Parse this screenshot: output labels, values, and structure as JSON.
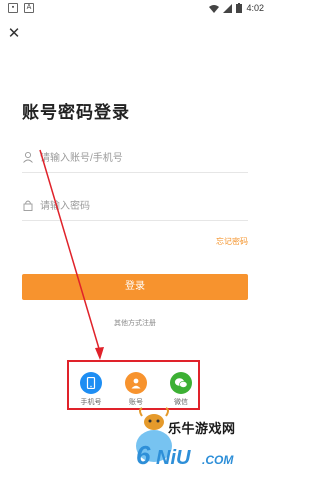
{
  "status_bar": {
    "time": "4:02",
    "left_icons": [
      "notification-badge-icon",
      "a-badge-icon"
    ],
    "right_icons": [
      "wifi-icon",
      "signal-icon",
      "battery-icon"
    ]
  },
  "page": {
    "title": "账号密码登录"
  },
  "account_field": {
    "placeholder": "请输入账号/手机号",
    "icon": "user-icon"
  },
  "password_field": {
    "placeholder": "请输入密码",
    "icon": "lock-icon"
  },
  "forgot_password": "忘记密码",
  "login_button": "登录",
  "other_methods": {
    "label": "其他方式注册",
    "options": [
      {
        "label": "手机号",
        "icon": "phone-icon",
        "color": "#1e8ef3"
      },
      {
        "label": "账号",
        "icon": "person-icon",
        "color": "#f7932e"
      },
      {
        "label": "微信",
        "icon": "wechat-icon",
        "color": "#3cb034"
      }
    ]
  },
  "watermark": {
    "text": "乐牛游戏网",
    "logo_text": "6NiU.COM"
  },
  "colors": {
    "accent": "#f7932e",
    "annotation": "#e0222a"
  }
}
